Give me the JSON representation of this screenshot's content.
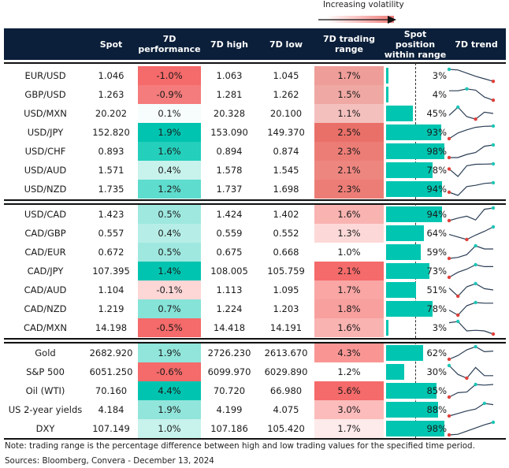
{
  "legend": {
    "label": "Increasing volatility"
  },
  "columns": [
    "",
    "Spot",
    "7D performance",
    "7D high",
    "7D low",
    "7D trading range",
    "Spot position within range",
    "7D trend"
  ],
  "header_lines": {
    "spot": "Spot",
    "perf1": "7D",
    "perf2": "performance",
    "high": "7D high",
    "low": "7D low",
    "range1": "7D trading",
    "range2": "range",
    "pos1": "Spot position",
    "pos2": "within range",
    "trend": "7D trend"
  },
  "colors": {
    "header_bg": "#0b1f3a",
    "bar": "#00c5b0",
    "spark_line": "#2b3e55",
    "spark_high": "#1cc6b6",
    "spark_low": "#e0403a"
  },
  "groups": [
    {
      "rows": [
        {
          "label": "EUR/USD",
          "spot": "1.046",
          "perf": "-1.0%",
          "perf_bg": "#f56a6a",
          "high": "1.063",
          "low": "1.045",
          "range": "1.7%",
          "range_bg": "#ef9d99",
          "position": 3,
          "position_label": "3%",
          "trend": [
            1.0,
            0.95,
            0.7,
            0.45,
            0.25,
            0.05
          ],
          "trend_hi": 0,
          "trend_lo": 5
        },
        {
          "label": "GBP/USD",
          "spot": "1.263",
          "perf": "-0.9%",
          "perf_bg": "#f57c7c",
          "high": "1.281",
          "low": "1.262",
          "range": "1.5%",
          "range_bg": "#efa8a3",
          "position": 4,
          "position_label": "4%",
          "trend": [
            0.8,
            0.8,
            0.95,
            0.85,
            0.3,
            0.05
          ],
          "trend_hi": 2,
          "trend_lo": 5
        },
        {
          "label": "USD/MXN",
          "spot": "20.202",
          "perf": "0.1%",
          "perf_bg": "#f6fdfc",
          "high": "20.328",
          "low": "20.100",
          "range": "1.1%",
          "range_bg": "#f4c0be",
          "position": 45,
          "position_label": "45%",
          "trend": [
            0.35,
            1.0,
            0.25,
            0.05,
            0.6,
            0.5
          ],
          "trend_hi": 1,
          "trend_lo": 3
        },
        {
          "label": "USD/JPY",
          "spot": "152.820",
          "perf": "1.9%",
          "perf_bg": "#00c4b0",
          "high": "153.090",
          "low": "149.370",
          "range": "2.5%",
          "range_bg": "#e97068",
          "position": 93,
          "position_label": "93%",
          "trend": [
            0.0,
            0.45,
            0.7,
            0.9,
            0.98,
            1.0
          ],
          "trend_hi": 5,
          "trend_lo": 0
        },
        {
          "label": "USD/CHF",
          "spot": "0.893",
          "perf": "1.6%",
          "perf_bg": "#24cfbc",
          "high": "0.894",
          "low": "0.874",
          "range": "2.3%",
          "range_bg": "#ec7d76",
          "position": 98,
          "position_label": "98%",
          "trend": [
            0.0,
            0.0,
            0.25,
            0.4,
            0.9,
            1.0
          ],
          "trend_hi": 5,
          "trend_lo": 0
        },
        {
          "label": "USD/AUD",
          "spot": "1.571",
          "perf": "0.4%",
          "perf_bg": "#c8f2ec",
          "high": "1.578",
          "low": "1.545",
          "range": "2.1%",
          "range_bg": "#ee8680",
          "position": 78,
          "position_label": "78%",
          "trend": [
            0.6,
            0.0,
            0.85,
            0.97,
            0.98,
            1.0
          ],
          "trend_hi": 5,
          "trend_lo": 0
        },
        {
          "label": "USD/NZD",
          "spot": "1.735",
          "perf": "1.2%",
          "perf_bg": "#5edccd",
          "high": "1.737",
          "low": "1.698",
          "range": "2.3%",
          "range_bg": "#ec7d76",
          "position": 94,
          "position_label": "94%",
          "trend": [
            0.25,
            0.0,
            0.7,
            0.8,
            0.95,
            1.0
          ],
          "trend_hi": 5,
          "trend_lo": 0
        }
      ]
    },
    {
      "rows": [
        {
          "label": "USD/CAD",
          "spot": "1.423",
          "perf": "0.5%",
          "perf_bg": "#9ee8df",
          "high": "1.424",
          "low": "1.402",
          "range": "1.6%",
          "range_bg": "#f9b3b1",
          "position": 94,
          "position_label": "94%",
          "trend": [
            0.0,
            0.2,
            0.35,
            0.05,
            0.9,
            1.0
          ],
          "trend_hi": 5,
          "trend_lo": 0
        },
        {
          "label": "CAD/GBP",
          "spot": "0.557",
          "perf": "0.4%",
          "perf_bg": "#b6eee7",
          "high": "0.559",
          "low": "0.552",
          "range": "1.3%",
          "range_bg": "#fcd9d8",
          "position": 64,
          "position_label": "64%",
          "trend": [
            0.4,
            0.2,
            0.0,
            0.35,
            0.65,
            1.0
          ],
          "trend_hi": 5,
          "trend_lo": 2
        },
        {
          "label": "CAD/EUR",
          "spot": "0.672",
          "perf": "0.5%",
          "perf_bg": "#9ee8df",
          "high": "0.675",
          "low": "0.668",
          "range": "1.0%",
          "range_bg": "#ffffff",
          "position": 59,
          "position_label": "59%",
          "trend": [
            0.0,
            0.08,
            0.3,
            1.0,
            0.75,
            0.75
          ],
          "trend_hi": 3,
          "trend_lo": 0
        },
        {
          "label": "CAD/JPY",
          "spot": "107.395",
          "perf": "1.4%",
          "perf_bg": "#00c4b0",
          "high": "108.005",
          "low": "105.759",
          "range": "2.1%",
          "range_bg": "#f56a6a",
          "position": 73,
          "position_label": "73%",
          "trend": [
            0.0,
            0.4,
            0.65,
            1.0,
            0.85,
            0.85
          ],
          "trend_hi": 3,
          "trend_lo": 0
        },
        {
          "label": "CAD/AUD",
          "spot": "1.104",
          "perf": "-0.1%",
          "perf_bg": "#fdd6d6",
          "high": "1.113",
          "low": "1.095",
          "range": "1.7%",
          "range_bg": "#f9a6a4",
          "position": 51,
          "position_label": "51%",
          "trend": [
            0.65,
            0.0,
            0.75,
            1.0,
            0.6,
            0.5
          ],
          "trend_hi": 3,
          "trend_lo": 1
        },
        {
          "label": "CAD/NZD",
          "spot": "1.219",
          "perf": "0.7%",
          "perf_bg": "#86e3d8",
          "high": "1.224",
          "low": "1.203",
          "range": "1.8%",
          "range_bg": "#f8a09e",
          "position": 78,
          "position_label": "78%",
          "trend": [
            0.4,
            0.0,
            0.75,
            1.0,
            0.95,
            0.95
          ],
          "trend_hi": 3,
          "trend_lo": 1
        },
        {
          "label": "CAD/MXN",
          "spot": "14.198",
          "perf": "-0.5%",
          "perf_bg": "#f56a6a",
          "high": "14.418",
          "low": "14.191",
          "range": "1.6%",
          "range_bg": "#f9b3b1",
          "position": 3,
          "position_label": "3%",
          "trend": [
            0.9,
            1.0,
            0.25,
            0.3,
            0.25,
            0.0
          ],
          "trend_hi": 1,
          "trend_lo": 5
        }
      ]
    },
    {
      "rows": [
        {
          "label": "Gold",
          "spot": "2682.920",
          "perf": "1.9%",
          "perf_bg": "#91e5db",
          "high": "2726.230",
          "low": "2613.670",
          "range": "4.3%",
          "range_bg": "#f99694",
          "position": 62,
          "position_label": "62%",
          "trend": [
            0.0,
            0.3,
            0.75,
            1.0,
            0.6,
            0.65
          ],
          "trend_hi": 3,
          "trend_lo": 0
        },
        {
          "label": "S&P 500",
          "spot": "6051.250",
          "perf": "-0.6%",
          "perf_bg": "#f56a6a",
          "high": "6099.970",
          "low": "6029.890",
          "range": "1.2%",
          "range_bg": "#ffffff",
          "position": 30,
          "position_label": "30%",
          "trend": [
            1.0,
            0.3,
            0.0,
            0.85,
            0.2,
            0.2
          ],
          "trend_hi": 0,
          "trend_lo": 2
        },
        {
          "label": "Oil (WTI)",
          "spot": "70.160",
          "perf": "4.4%",
          "perf_bg": "#00c4b0",
          "high": "70.720",
          "low": "66.980",
          "range": "5.6%",
          "range_bg": "#f56a6a",
          "position": 85,
          "position_label": "85%",
          "trend": [
            0.0,
            0.35,
            0.4,
            1.0,
            0.95,
            1.0
          ],
          "trend_hi": 3,
          "trend_lo": 0
        },
        {
          "label": "US 2-year yields",
          "spot": "4.184",
          "perf": "1.9%",
          "perf_bg": "#91e5db",
          "high": "4.199",
          "low": "4.075",
          "range": "3.0%",
          "range_bg": "#fbbcbb",
          "position": 88,
          "position_label": "88%",
          "trend": [
            0.0,
            0.2,
            0.4,
            0.55,
            1.0,
            0.9
          ],
          "trend_hi": 4,
          "trend_lo": 0
        },
        {
          "label": "DXY",
          "spot": "107.149",
          "perf": "1.0%",
          "perf_bg": "#c8f2ec",
          "high": "107.186",
          "low": "105.420",
          "range": "1.7%",
          "range_bg": "#fdeaea",
          "position": 98,
          "position_label": "98%",
          "trend": [
            0.0,
            0.05,
            0.3,
            0.55,
            0.8,
            1.0
          ],
          "trend_hi": 5,
          "trend_lo": 0
        }
      ]
    }
  ],
  "footer": {
    "note": "Note: trading range is the percentage difference between high and low trading values for the specified time period.",
    "sources": "Sources: Bloomberg, Convera - December 13, 2024"
  }
}
